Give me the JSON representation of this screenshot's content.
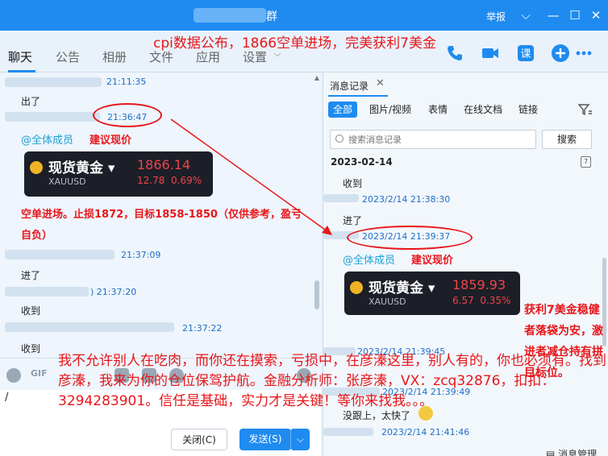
{
  "window": {
    "title_suffix": "群",
    "report": "举报"
  },
  "tabs": [
    "聊天",
    "公告",
    "相册",
    "文件",
    "应用",
    "设置"
  ],
  "headline": "cpi数据公布，1866空单进场，完美获利7美金",
  "chat": {
    "messages": [
      {
        "time": "21:11:35",
        "text": "出了"
      },
      {
        "time": "21:36:47",
        "mention": "@全体成员",
        "note": "建议现价"
      },
      {
        "time": "21:37:09",
        "text": "进了"
      },
      {
        "time": "21:37:20",
        "text": "收到"
      },
      {
        "time": "21:37:22",
        "text": "收到"
      }
    ],
    "quote_left": {
      "name": "现货黄金",
      "symbol": "XAUUSD",
      "price": "1866.14",
      "change": "12.78",
      "change_pct": "0.69%"
    },
    "trade_note": "空单进场。止损1872，目标1858-1850（仅供参考，盈亏自负）"
  },
  "input": {
    "text": "/",
    "close": "关闭(C)",
    "send": "发送(S)"
  },
  "history": {
    "tab_label": "消息记录",
    "filters": [
      "全部",
      "图片/视频",
      "表情",
      "在线文档",
      "链接"
    ],
    "search_placeholder": "搜索消息记录",
    "search_button": "搜索",
    "date": "2023-02-14",
    "messages": [
      {
        "text": "收到",
        "time": "2023/2/14 21:38:30"
      },
      {
        "text": "进了",
        "time": "2023/2/14 21:39:37"
      },
      {
        "mention": "@全体成员",
        "note": "建议现价"
      },
      {
        "time": "2023/2/14 21:39:45"
      },
      {
        "time": "2023/2/14 21:39:49"
      },
      {
        "text": "没跟上，太快了",
        "time": "2023/2/14 21:41:46"
      }
    ],
    "quote_right": {
      "name": "现货黄金",
      "symbol": "XAUUSD",
      "price": "1859.93",
      "change": "6.57",
      "change_pct": "0.35%"
    },
    "manage": "消息管理"
  },
  "overlay": {
    "profit_note": "获利7美金稳健者落袋为安，激进者减仓持有拼目标位。",
    "promo": "我不允许别人在吃肉，而你还在摸索，亏损中，在彦溱这里，别人有的，你也必须有。找到彦溱，我来为你的仓位保驾护航。金融分析师：张彦溱，VX：zcq32876，扣扣：3294283901。信任是基础，实力才是关键！等你来找我。。。"
  },
  "colors": {
    "brand": "#1f8bf0",
    "annotation": "#e8161a",
    "price_red": "#f0434b"
  }
}
